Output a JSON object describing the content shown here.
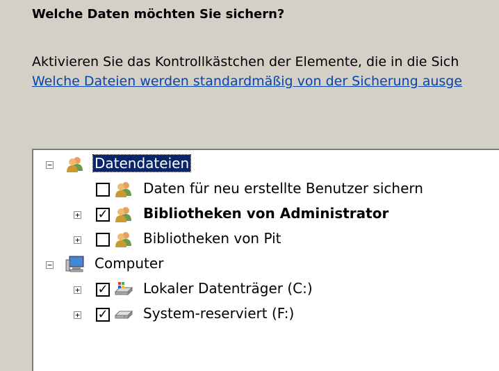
{
  "heading": "Welche Daten möchten Sie sichern?",
  "description": "Aktivieren Sie das Kontrollkästchen der Elemente, die in die Sich",
  "link_text": "Welche Dateien werden standardmäßig von der Sicherung ausge",
  "tree": {
    "data_files": {
      "label": "Datendateien",
      "expander": "−",
      "children": {
        "new_users": {
          "label": "Daten für neu erstellte Benutzer sichern",
          "checked": false
        },
        "admin_libs": {
          "label": "Bibliotheken von Administrator",
          "checked": true,
          "expander": "+"
        },
        "pit_libs": {
          "label": "Bibliotheken von Pit",
          "checked": false,
          "expander": "+"
        }
      }
    },
    "computer": {
      "label": "Computer",
      "expander": "−",
      "children": {
        "local_disk": {
          "label": "Lokaler Datenträger (C:)",
          "checked": true,
          "expander": "+"
        },
        "system_reserved": {
          "label": "System-reserviert (F:)",
          "checked": true,
          "expander": "+"
        }
      }
    }
  },
  "checkmark": "✓"
}
